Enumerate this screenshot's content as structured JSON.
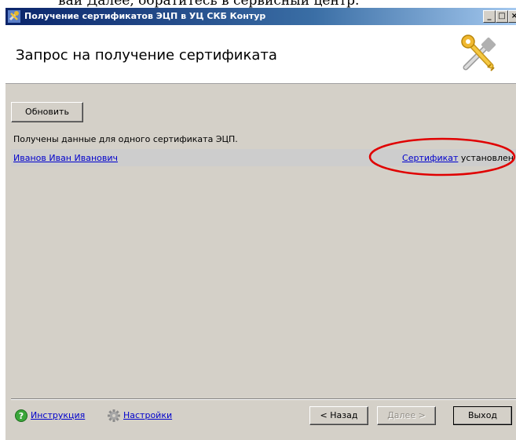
{
  "caption_fragment": "вай Далее, обратитесь в сервисный центр.",
  "window": {
    "title": "Получение сертификатов ЭЦП в УЦ СКБ Контур",
    "minimize_glyph": "_",
    "maximize_glyph": "□",
    "close_glyph": "×"
  },
  "header": {
    "title": "Запрос на получение сертификата",
    "icon": "keys-wizard-icon"
  },
  "toolbar": {
    "refresh_label": "Обновить"
  },
  "status_message": "Получены данные для одного сертификата ЭЦП.",
  "certificates": [
    {
      "owner": "Иванов Иван Иванович",
      "cert_link": "Сертификат",
      "status": "установлен"
    }
  ],
  "footer": {
    "help_label": "Инструкция",
    "settings_label": "Настройки",
    "back_label": "< Назад",
    "next_label": "Далее >",
    "exit_label": "Выход"
  },
  "colors": {
    "dialog_bg": "#d4d0c8",
    "link": "#0000cc",
    "highlight": "#e00000",
    "row_bg": "#cdcdcd"
  }
}
